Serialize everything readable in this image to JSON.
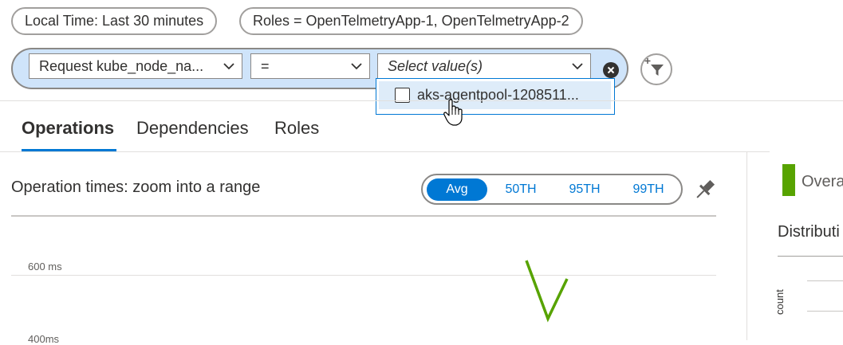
{
  "filters": {
    "time_pill": "Local Time: Last 30 minutes",
    "roles_pill": "Roles = OpenTelmetryApp-1, OpenTelmetryApp-2",
    "edit": {
      "property": "Request kube_node_na...",
      "operator": "=",
      "value_placeholder": "Select value(s)"
    },
    "dropdown_options": [
      "aks-agentpool-1208511..."
    ]
  },
  "tabs": [
    "Operations",
    "Dependencies",
    "Roles"
  ],
  "active_tab": "Operations",
  "panel": {
    "title": "Operation times: zoom into a range",
    "percentiles": [
      "Avg",
      "50TH",
      "95TH",
      "99TH"
    ],
    "active_percentile": "Avg",
    "y_axis_labels": [
      "600 ms",
      "400ms"
    ]
  },
  "side": {
    "legend": "Overa",
    "distribution_title": "Distributi",
    "count_label": "count"
  },
  "colors": {
    "accent": "#0078d4",
    "series": "#57a300",
    "filter_pill_bg": "#cfe4fa"
  },
  "icons": [
    "chevron-down-icon",
    "clear-icon",
    "add-filter-icon",
    "pin-icon",
    "hand-cursor-icon"
  ]
}
